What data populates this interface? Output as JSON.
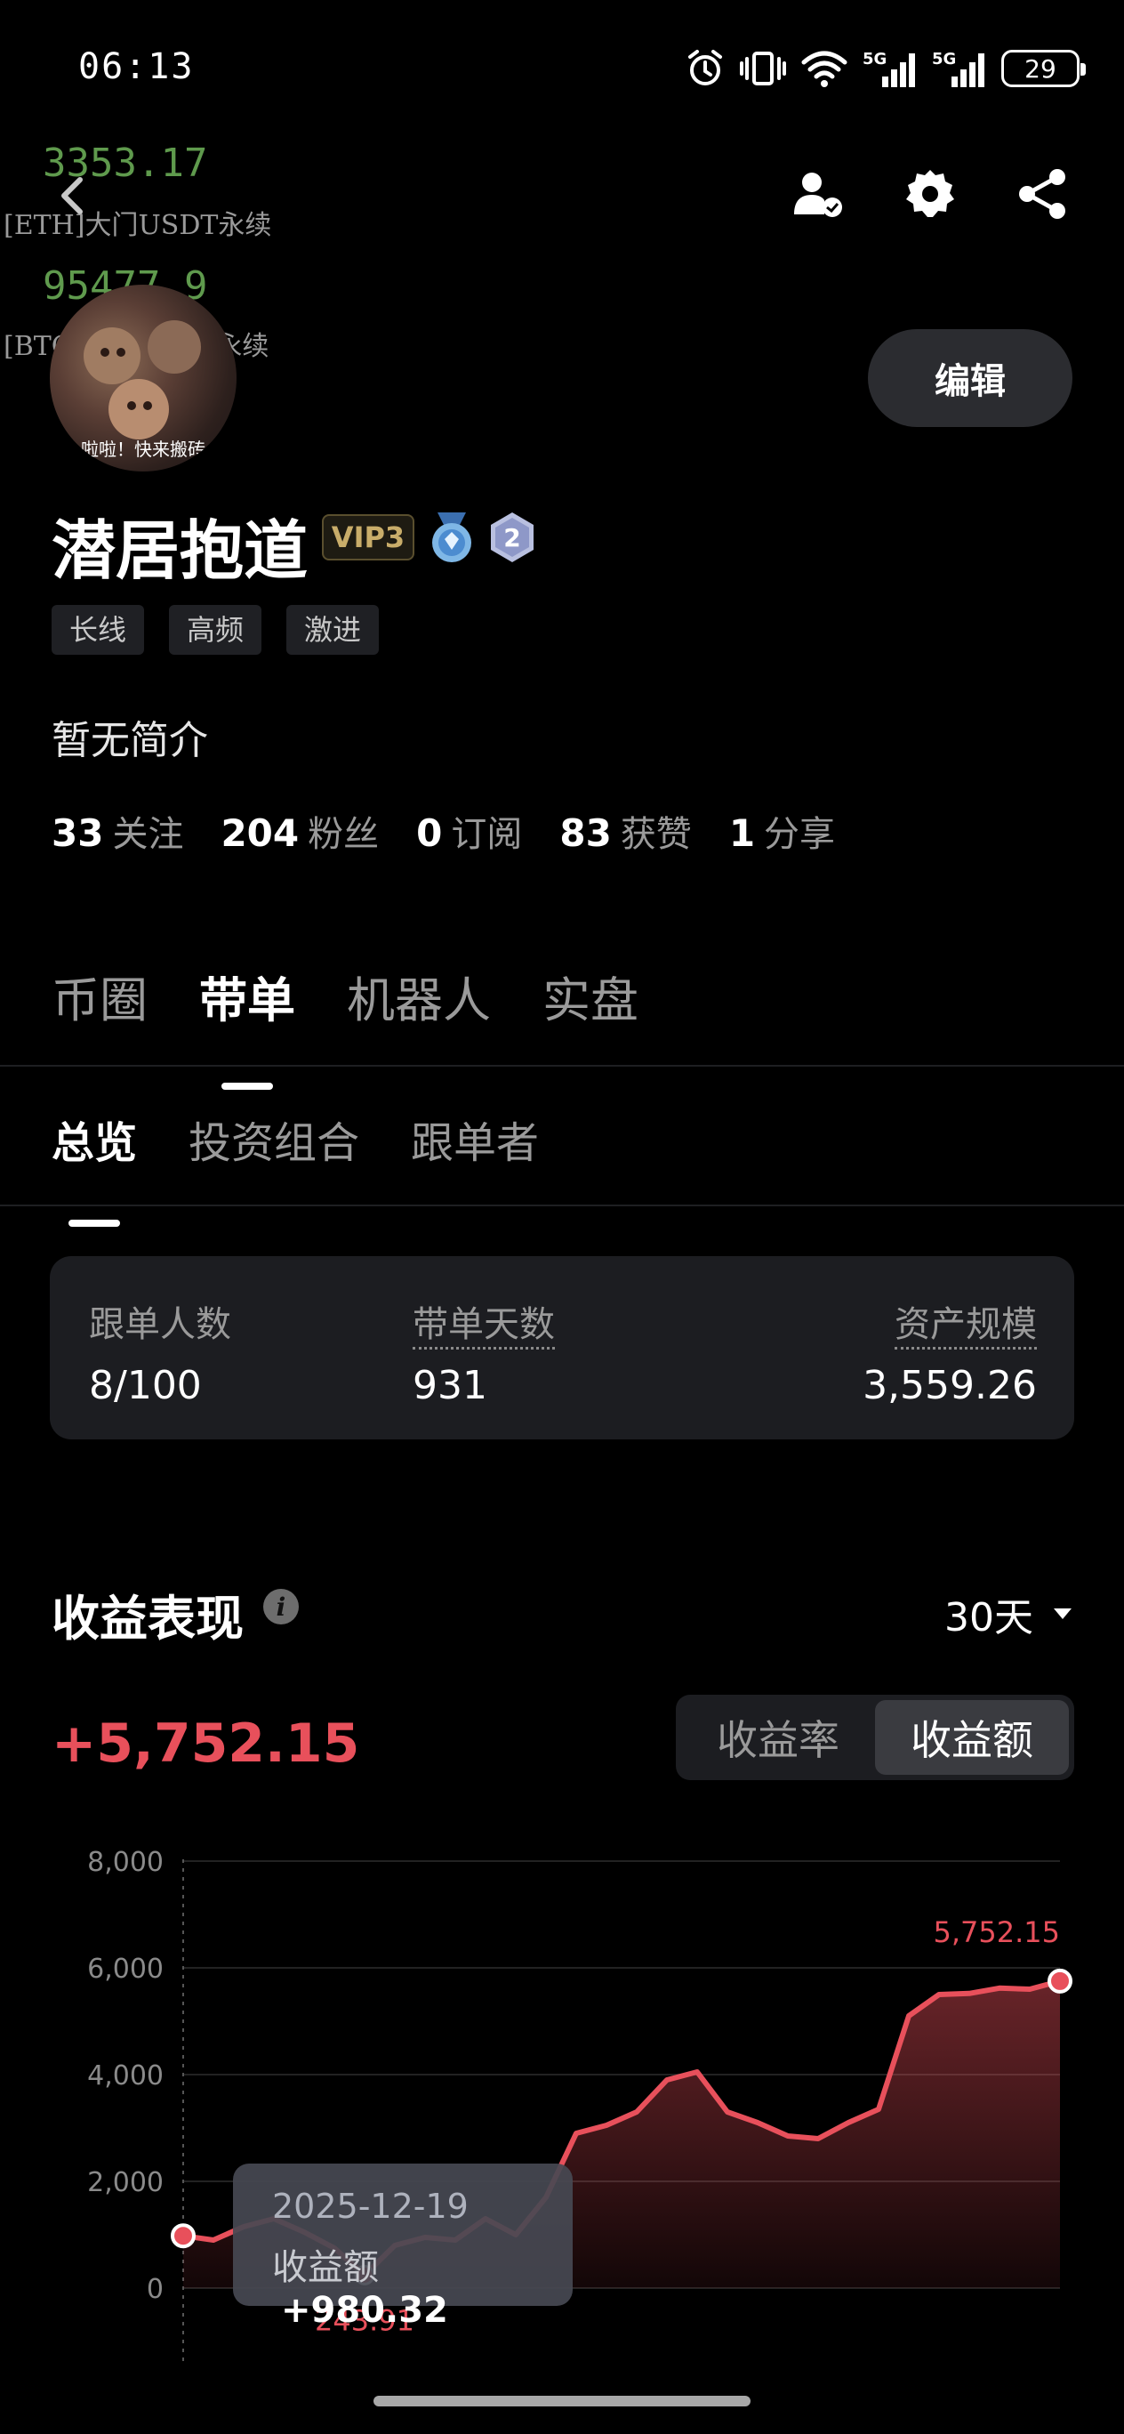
{
  "status_bar": {
    "time": "06:13",
    "battery": "29",
    "network_1": "5G",
    "network_2": "5G"
  },
  "ticker": {
    "items": [
      {
        "price": "3353.17",
        "label": "[ETH]大门USDT永续"
      },
      {
        "price": "95477.9",
        "label": "[BTC]大门USDT永续"
      }
    ]
  },
  "header": {
    "back_icon": "chevron-left-icon",
    "icons": [
      "user-check-icon",
      "gear-icon",
      "share-icon"
    ]
  },
  "profile": {
    "avatar_caption": "啦啦！快来搬砖",
    "edit_label": "编辑",
    "name": "潜居抱道",
    "vip": "VIP3",
    "level_badge": "2",
    "tags": [
      "长线",
      "高频",
      "激进"
    ],
    "bio": "暂无简介",
    "stats": [
      {
        "num": "33",
        "label": "关注"
      },
      {
        "num": "204",
        "label": "粉丝"
      },
      {
        "num": "0",
        "label": "订阅"
      },
      {
        "num": "83",
        "label": "获赞"
      },
      {
        "num": "1",
        "label": "分享"
      }
    ]
  },
  "main_tabs": [
    "币圈",
    "带单",
    "机器人",
    "实盘"
  ],
  "sub_tabs": [
    "总览",
    "投资组合",
    "跟单者"
  ],
  "summary": {
    "followers_label": "跟单人数",
    "followers_value": "8/100",
    "days_label": "带单天数",
    "days_value": "931",
    "aum_label": "资产规模",
    "aum_value": "3,559.26"
  },
  "performance": {
    "title": "收益表现",
    "period": "30天",
    "total": "+5,752.15",
    "toggle": [
      "收益率",
      "收益额"
    ],
    "tooltip": {
      "date": "2025-12-19",
      "label": "收益额",
      "value": "+980.32"
    },
    "max_label": "5,752.15",
    "min_label": "243.91"
  },
  "colors": {
    "accent_red": "#e8505b",
    "ticker_green": "#5f9a4d",
    "card": "#1c1d21"
  },
  "chart_data": {
    "type": "area",
    "title": "",
    "xlabel": "",
    "ylabel": "",
    "ylim": [
      0,
      8000
    ],
    "yticks": [
      "8,000",
      "6,000",
      "4,000",
      "2,000",
      "0"
    ],
    "series": [
      {
        "values": [
          980,
          900,
          1150,
          1300,
          1050,
          750,
          243.91,
          800,
          950,
          900,
          1300,
          1000,
          1700,
          2900,
          3050,
          3300,
          3900,
          4050,
          3300,
          3100,
          2850,
          2800,
          3100,
          3350,
          5100,
          5500,
          5520,
          5620,
          5600,
          5752.15
        ]
      }
    ]
  }
}
